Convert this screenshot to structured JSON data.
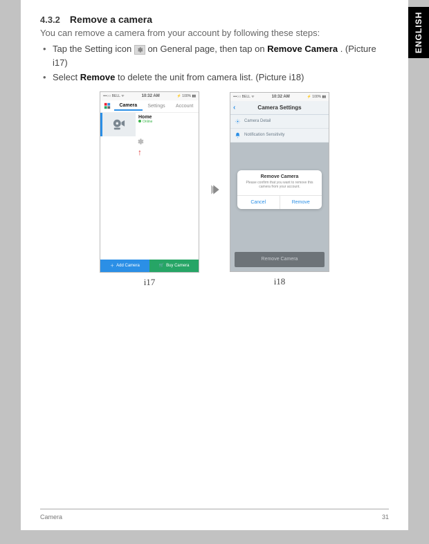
{
  "page": {
    "side_tab": "ENGLISH",
    "section_number": "4.3.2",
    "section_title": "Remove a camera",
    "intro": "You can remove a camera from your account by following these steps:",
    "step1_a": "Tap the Setting icon ",
    "step1_b": " on General page, then tap on ",
    "step1_bold": "Remove Camera",
    "step1_c": ". (Picture i17)",
    "step2_a": "Select ",
    "step2_bold": "Remove",
    "step2_b": " to delete the unit from camera list. (Picture i18)",
    "footer_left": "Camera",
    "footer_right": "31"
  },
  "phone17": {
    "status_left": "•••○○ BELL ᯤ",
    "status_time": "10:32 AM",
    "status_right": "⚡ 100% ▮▮",
    "tab_camera": "Camera",
    "tab_settings": "Settings",
    "tab_account": "Account",
    "camera_name": "Home",
    "camera_status": "Online",
    "btn_add": "Add Camera",
    "btn_buy": "Buy Camera",
    "caption": "i17"
  },
  "phone18": {
    "status_left": "•••○○ BELL ᯤ",
    "status_time": "10:32 AM",
    "status_right": "⚡ 100% ▮▮",
    "header": "Camera Settings",
    "item_detail": "Camera Detail",
    "item_notif": "Notification Sensitivity",
    "modal_title": "Remove Camera",
    "modal_text": "Please confirm that you want to remove this camera from your account.",
    "modal_cancel": "Cancel",
    "modal_remove": "Remove",
    "remove_bar": "Remove Camera",
    "caption": "i18"
  }
}
